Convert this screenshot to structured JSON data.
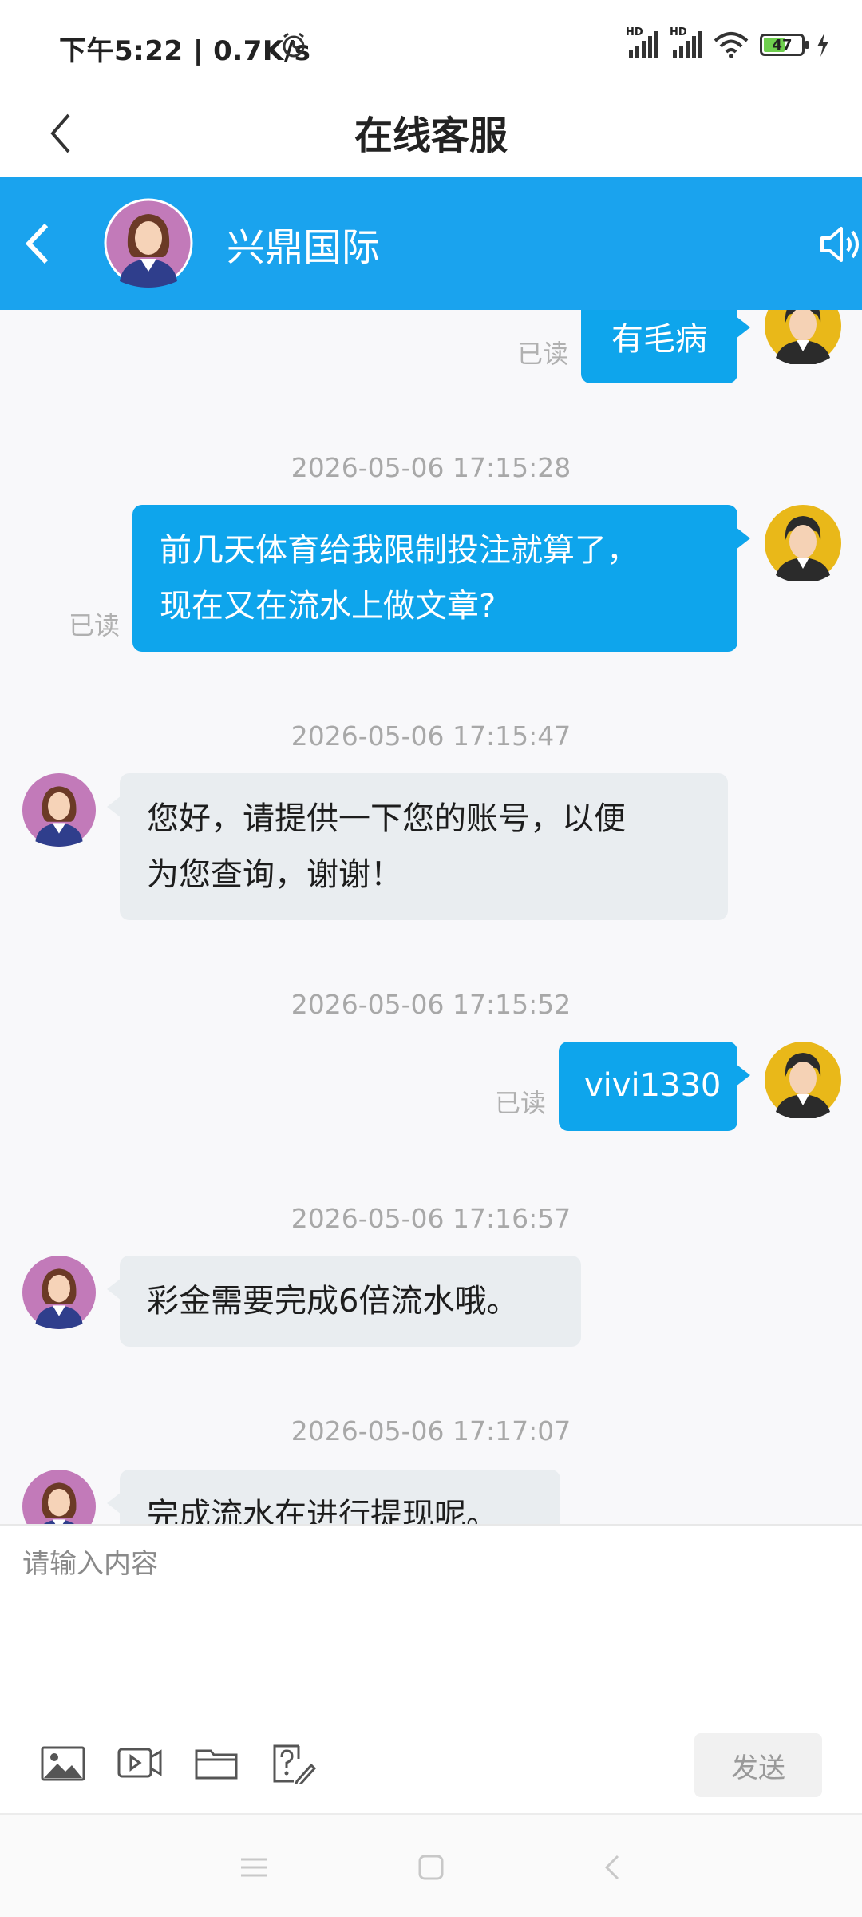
{
  "status_bar": {
    "time_speed": "下午5:22 | 0.7K/s",
    "battery": "47"
  },
  "title_bar": {
    "title": "在线客服"
  },
  "chat_header": {
    "name": "兴鼎国际"
  },
  "messages": [
    {
      "side": "me",
      "text": "有毛病",
      "read": "已读"
    },
    {
      "time": "2026-05-06 17:15:28",
      "side": "me",
      "lines": [
        "前几天体育给我限制投注就算了，",
        "现在又在流水上做文章?"
      ],
      "read": "已读"
    },
    {
      "time": "2026-05-06 17:15:47",
      "side": "cs",
      "lines": [
        "您好，请提供一下您的账号，以便",
        "为您查询，谢谢！"
      ]
    },
    {
      "time": "2026-05-06 17:15:52",
      "side": "me",
      "text": "vivi1330",
      "read": "已读"
    },
    {
      "time": "2026-05-06 17:16:57",
      "side": "cs",
      "text": "彩金需要完成6倍流水哦。"
    },
    {
      "time": "2026-05-06 17:17:07",
      "side": "cs",
      "text": "完成流水在进行提现呢。"
    }
  ],
  "input": {
    "placeholder": "请输入内容",
    "send_label": "发送"
  },
  "colors": {
    "accent": "#1aa3ee",
    "my_bubble": "#0ea5ec",
    "cs_bubble": "#e9edf0"
  }
}
